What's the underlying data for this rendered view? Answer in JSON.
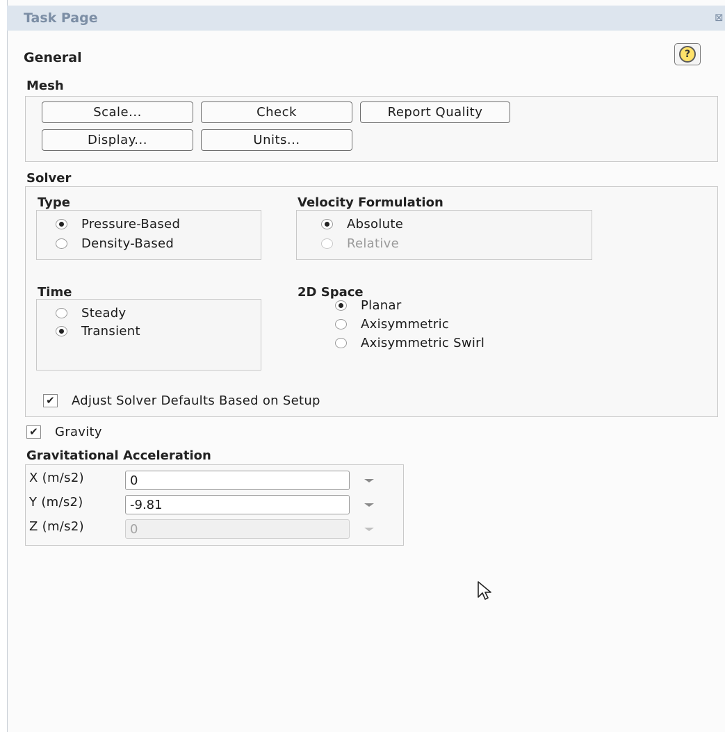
{
  "window": {
    "title": "Task Page",
    "close_glyph": "⊠"
  },
  "page": {
    "heading": "General",
    "help_glyph": "?"
  },
  "mesh": {
    "label": "Mesh",
    "buttons": {
      "scale": "Scale...",
      "check": "Check",
      "report_quality": "Report Quality",
      "display": "Display...",
      "units": "Units..."
    }
  },
  "solver": {
    "label": "Solver",
    "type": {
      "label": "Type",
      "options": [
        "Pressure-Based",
        "Density-Based"
      ],
      "selected": "Pressure-Based"
    },
    "velocity_formulation": {
      "label": "Velocity Formulation",
      "options": [
        "Absolute",
        "Relative"
      ],
      "selected": "Absolute",
      "disabled": [
        "Relative"
      ]
    },
    "time": {
      "label": "Time",
      "options": [
        "Steady",
        "Transient"
      ],
      "selected": "Transient"
    },
    "space_2d": {
      "label": "2D Space",
      "options": [
        "Planar",
        "Axisymmetric",
        "Axisymmetric Swirl"
      ],
      "selected": "Planar"
    },
    "adjust_defaults": {
      "label": "Adjust Solver Defaults Based on Setup",
      "checked": true
    }
  },
  "gravity": {
    "label": "Gravity",
    "checked": true,
    "check_glyph": "✔"
  },
  "gravitational_acceleration": {
    "label": "Gravitational Acceleration",
    "x": {
      "label": "X (m/s2)",
      "value": "0"
    },
    "y": {
      "label": "Y (m/s2)",
      "value": "-9.81"
    },
    "z": {
      "label": "Z (m/s2)",
      "value": "0",
      "disabled": true
    }
  }
}
